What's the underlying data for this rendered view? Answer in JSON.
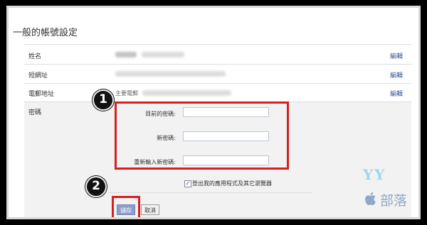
{
  "page": {
    "title": "一般的帳號設定"
  },
  "rows": {
    "name": {
      "label": "姓名",
      "edit": "編輯"
    },
    "short_url": {
      "label": "短網址",
      "edit": "編輯"
    },
    "email": {
      "label": "電郵地址",
      "primary_label": "主要電郵",
      "edit": "編輯"
    },
    "password": {
      "label": "密碼"
    }
  },
  "password_form": {
    "current_label": "目前的密碼:",
    "new_label": "新密碼:",
    "confirm_label": "重新輸入新密碼:",
    "current_value": "",
    "new_value": "",
    "confirm_value": ""
  },
  "logout_option": {
    "checked": true,
    "label": "登出我的應用程式及其它瀏覽器"
  },
  "buttons": {
    "save": "儲存",
    "cancel": "取消"
  },
  "annotations": {
    "step1": "1",
    "step2": "2"
  },
  "watermark": {
    "logo_text": "YY",
    "text": "部落"
  },
  "colors": {
    "highlight": "#d62020",
    "link": "#3b5998",
    "save_button": "#8c9fc6"
  }
}
